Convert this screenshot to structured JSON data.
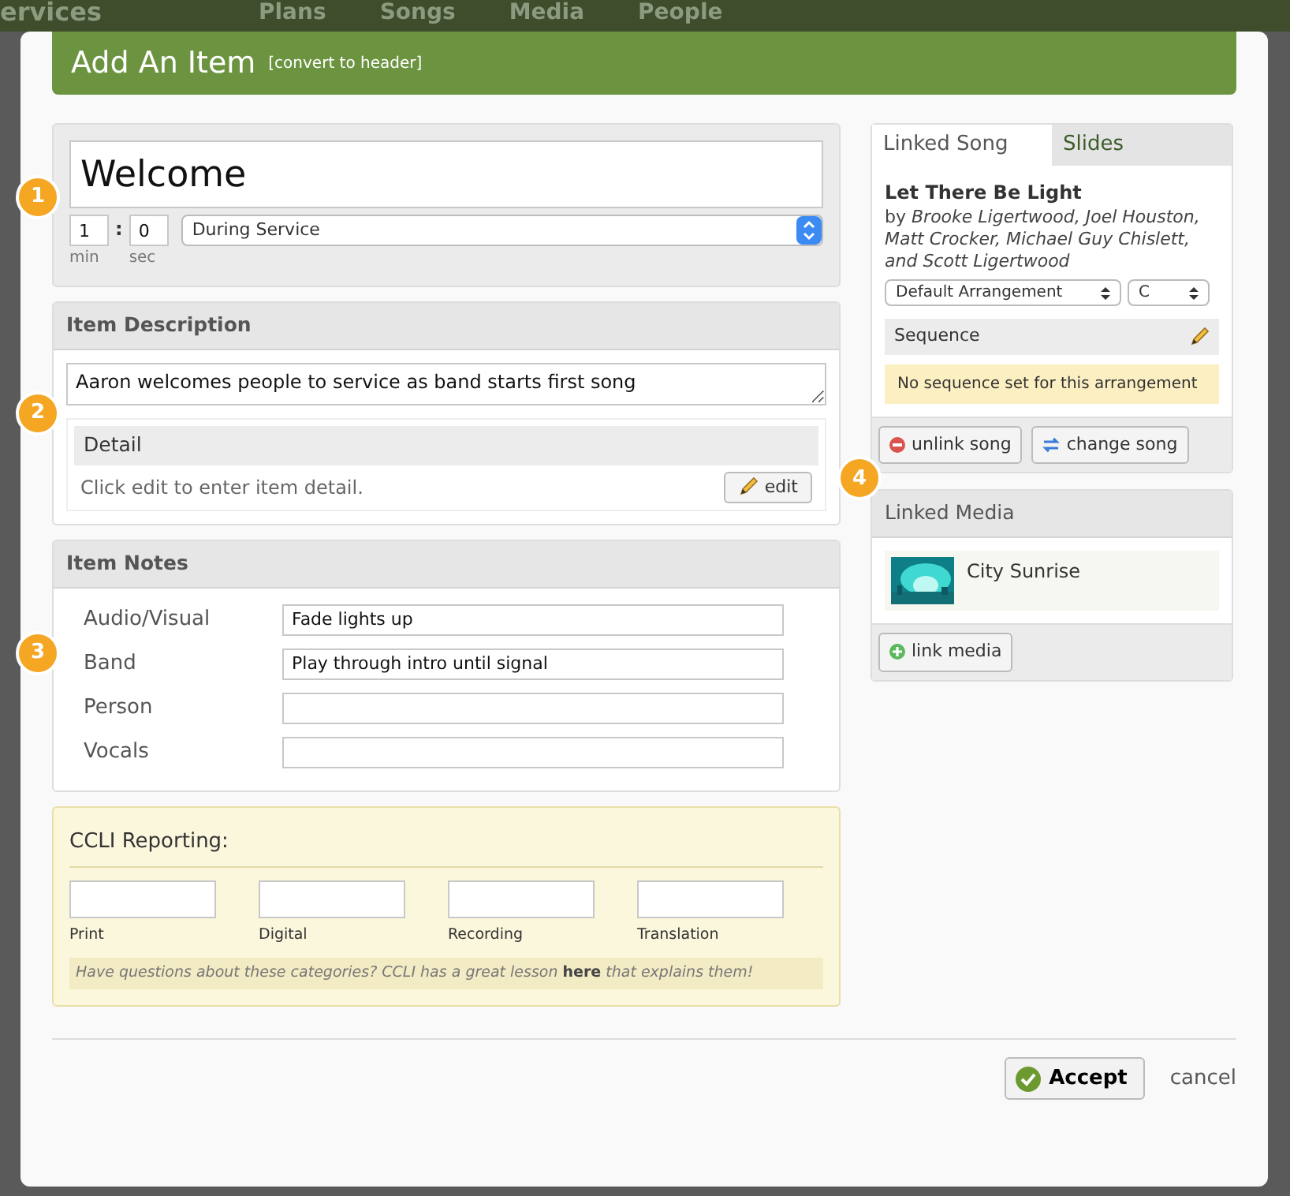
{
  "background_nav": {
    "brand": "ervices",
    "links": [
      "Plans",
      "Songs",
      "Media",
      "People"
    ]
  },
  "dialog": {
    "title": "Add An Item",
    "title_link": "[convert to header]"
  },
  "item": {
    "title": "Welcome",
    "minutes": "1",
    "separator": ":",
    "seconds": "0",
    "min_label": "min",
    "sec_label": "sec",
    "timing": "During Service"
  },
  "description": {
    "heading": "Item Description",
    "text": "Aaron welcomes people to service as band starts first song",
    "detail_heading": "Detail",
    "detail_hint": "Click edit to enter item detail.",
    "edit_button": "edit"
  },
  "notes": {
    "heading": "Item Notes",
    "rows": [
      {
        "label": "Audio/Visual",
        "value": "Fade lights up"
      },
      {
        "label": "Band",
        "value": "Play through intro until signal"
      },
      {
        "label": "Person"
      },
      {
        "label": "Vocals"
      }
    ]
  },
  "ccli": {
    "heading": "CCLI Reporting:",
    "fields": [
      {
        "label": "Print"
      },
      {
        "label": "Digital"
      },
      {
        "label": "Recording"
      },
      {
        "label": "Translation"
      }
    ],
    "help_before": "Have questions about these categories? CCLI has a great lesson",
    "help_link": "here",
    "help_after": "that explains them!"
  },
  "song_tabs": [
    {
      "label": "Linked Song",
      "selected": true
    },
    {
      "label": "Slides",
      "selected": false
    }
  ],
  "song": {
    "title": "Let There Be Light",
    "byline": "by *Brooke Ligertwood, Joel Houston, Matt Crocker, Michael Guy Chislett, and Scott Ligertwood*",
    "arrangement": "Default Arrangement",
    "key": "C",
    "sequence_heading": "Sequence",
    "sequence_empty": "No sequence set for this arrangement",
    "buttons": [
      {
        "label": "unlink song",
        "kind": "unlink"
      },
      {
        "label": "change song",
        "kind": "change"
      }
    ]
  },
  "media": {
    "heading": "Linked Media",
    "items": [
      {
        "title": "City Sunrise",
        "kind": "picture"
      }
    ],
    "link_button": "link media"
  },
  "footer": {
    "accept": "Accept",
    "cancel": "cancel"
  },
  "markers": [
    "1",
    "2",
    "3",
    "4"
  ]
}
